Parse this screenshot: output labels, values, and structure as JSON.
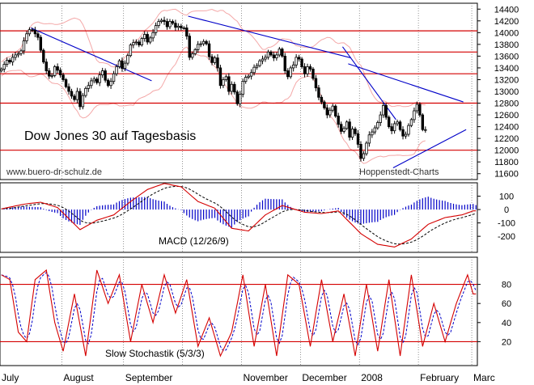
{
  "chart_data": {
    "type": "stock-chart",
    "title": "Dow Jones 30 auf Tagesbasis",
    "watermark_left": "www.buero-dr-schulz.de",
    "watermark_right": "Hoppenstedt-Charts",
    "months": [
      {
        "label": "July",
        "day": 0
      },
      {
        "label": "August",
        "day": 22
      },
      {
        "label": "September",
        "day": 44
      },
      {
        "label": "November",
        "day": 86
      },
      {
        "label": "December",
        "day": 107
      },
      {
        "label": "2008",
        "day": 128
      },
      {
        "label": "February",
        "day": 149
      },
      {
        "label": "Marc",
        "day": 168
      }
    ],
    "monthGridDays": [
      22,
      44,
      65,
      86,
      107,
      128,
      149,
      168
    ],
    "price": {
      "ylim": [
        11500,
        14500
      ],
      "ticks": [
        11600,
        11800,
        12000,
        12200,
        12400,
        12600,
        12800,
        13000,
        13200,
        13400,
        13600,
        13800,
        14000,
        14200,
        14400
      ],
      "colors": {
        "candle": "#000000",
        "up_body": "#ffffff",
        "band": "#f4a8a8",
        "hline": "#d40000",
        "trend": "#0000c8"
      },
      "horizontal_levels": [
        14030,
        13670,
        13300,
        12800,
        12000
      ],
      "trendlines": [
        {
          "from": [
            11,
            14080
          ],
          "to": [
            54,
            13180
          ]
        },
        {
          "from": [
            67,
            14280
          ],
          "to": [
            125,
            13570
          ]
        },
        {
          "from": [
            122,
            13760
          ],
          "to": [
            141,
            12520
          ]
        },
        {
          "from": [
            124,
            13470
          ],
          "to": [
            165,
            12820
          ]
        },
        {
          "from": [
            140,
            11700
          ],
          "to": [
            166,
            12350
          ]
        }
      ],
      "closes": [
        13380,
        13460,
        13530,
        13500,
        13580,
        13620,
        13640,
        13690,
        13860,
        13980,
        14050,
        14040,
        13980,
        13920,
        13700,
        13500,
        13350,
        13260,
        13270,
        13420,
        13360,
        13280,
        13200,
        13080,
        13000,
        12920,
        12860,
        13000,
        12740,
        12930,
        13050,
        13100,
        13180,
        13210,
        13150,
        13280,
        13350,
        13190,
        13100,
        13170,
        13300,
        13420,
        13520,
        13390,
        13480,
        13610,
        13790,
        13830,
        13840,
        13790,
        13900,
        13970,
        13840,
        13910,
        14000,
        14120,
        14190,
        14210,
        14190,
        14100,
        14190,
        14160,
        14090,
        14110,
        14080,
        14080,
        13940,
        13580,
        13640,
        13710,
        13800,
        13810,
        13850,
        13810,
        13590,
        13490,
        13570,
        13400,
        13100,
        13200,
        13250,
        13000,
        13120,
        12990,
        12790,
        12950,
        13170,
        13240,
        13260,
        13320,
        13410,
        13440,
        13520,
        13550,
        13580,
        13670,
        13620,
        13570,
        13620,
        13720,
        13600,
        13350,
        13250,
        13400,
        13450,
        13580,
        13550,
        13420,
        13300,
        13420,
        13380,
        13220,
        13060,
        12900,
        12820,
        12720,
        12600,
        12680,
        12750,
        12580,
        12440,
        12320,
        12370,
        12480,
        12220,
        12360,
        12280,
        12100,
        11860,
        11940,
        12120,
        12260,
        12310,
        12380,
        12470,
        12600,
        12760,
        12560,
        12400,
        12330,
        12450,
        12480,
        12350,
        12240,
        12270,
        12420,
        12520,
        12670,
        12780,
        12600,
        12350,
        12350
      ]
    },
    "macd": {
      "label": "MACD (12/26/9)",
      "ylim": [
        -320,
        200
      ],
      "ticks": [
        100,
        0,
        -100,
        -200
      ],
      "colors": {
        "macd": "#d40000",
        "signal": "#000000",
        "histogram": "#0000c8"
      },
      "keyframes": [
        [
          0,
          5
        ],
        [
          8,
          40
        ],
        [
          14,
          55
        ],
        [
          20,
          15
        ],
        [
          28,
          -150
        ],
        [
          34,
          -80
        ],
        [
          40,
          -40
        ],
        [
          46,
          60
        ],
        [
          52,
          150
        ],
        [
          58,
          195
        ],
        [
          64,
          170
        ],
        [
          70,
          60
        ],
        [
          76,
          10
        ],
        [
          82,
          -140
        ],
        [
          88,
          -160
        ],
        [
          94,
          -40
        ],
        [
          100,
          30
        ],
        [
          108,
          -20
        ],
        [
          114,
          -30
        ],
        [
          120,
          -10
        ],
        [
          128,
          -180
        ],
        [
          134,
          -260
        ],
        [
          140,
          -280
        ],
        [
          146,
          -220
        ],
        [
          152,
          -110
        ],
        [
          158,
          -60
        ],
        [
          164,
          -40
        ],
        [
          168,
          -10
        ]
      ]
    },
    "stochastic": {
      "label": "Slow Stochastik (5/3/3)",
      "ylim": [
        0,
        100
      ],
      "ticks": [
        80,
        60,
        40,
        20
      ],
      "colors": {
        "k": "#d40000",
        "d": "#0000c8",
        "level": "#d40000"
      },
      "levels": [
        80,
        20
      ],
      "keyframes": [
        [
          0,
          90
        ],
        [
          3,
          85
        ],
        [
          6,
          30
        ],
        [
          9,
          20
        ],
        [
          12,
          85
        ],
        [
          16,
          95
        ],
        [
          19,
          40
        ],
        [
          22,
          10
        ],
        [
          26,
          70
        ],
        [
          30,
          5
        ],
        [
          34,
          95
        ],
        [
          38,
          60
        ],
        [
          42,
          90
        ],
        [
          46,
          20
        ],
        [
          50,
          80
        ],
        [
          54,
          40
        ],
        [
          58,
          90
        ],
        [
          62,
          50
        ],
        [
          66,
          85
        ],
        [
          70,
          15
        ],
        [
          74,
          45
        ],
        [
          78,
          5
        ],
        [
          82,
          30
        ],
        [
          86,
          90
        ],
        [
          90,
          15
        ],
        [
          94,
          80
        ],
        [
          98,
          5
        ],
        [
          102,
          90
        ],
        [
          106,
          80
        ],
        [
          110,
          15
        ],
        [
          114,
          85
        ],
        [
          118,
          20
        ],
        [
          122,
          70
        ],
        [
          126,
          5
        ],
        [
          130,
          80
        ],
        [
          134,
          10
        ],
        [
          138,
          85
        ],
        [
          142,
          5
        ],
        [
          146,
          90
        ],
        [
          150,
          15
        ],
        [
          154,
          60
        ],
        [
          158,
          20
        ],
        [
          162,
          60
        ],
        [
          166,
          90
        ],
        [
          168,
          70
        ]
      ]
    }
  }
}
